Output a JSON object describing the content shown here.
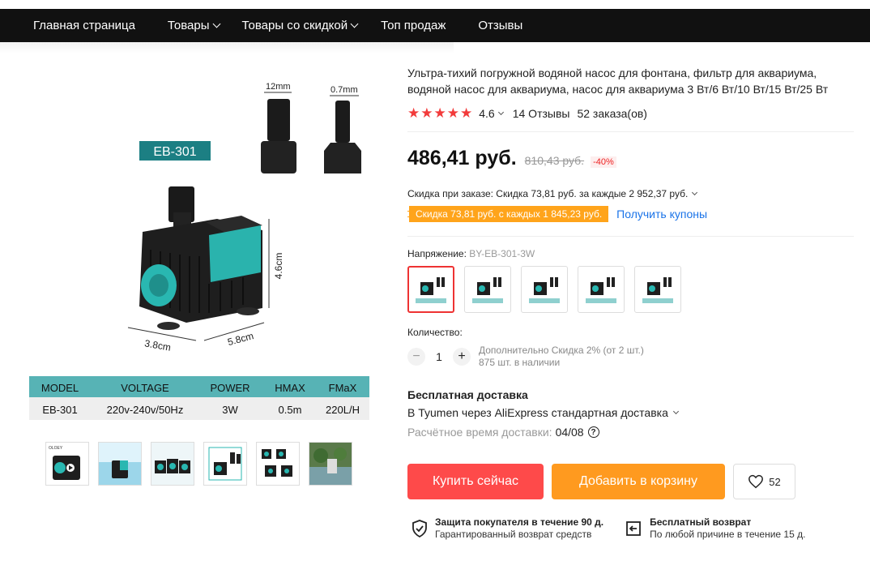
{
  "nav": {
    "items": [
      {
        "label": "Главная страница",
        "dropdown": false
      },
      {
        "label": "Товары",
        "dropdown": true
      },
      {
        "label": "Товары со скидкой",
        "dropdown": true
      },
      {
        "label": "Топ продаж",
        "dropdown": false
      },
      {
        "label": "Отзывы",
        "dropdown": false
      }
    ]
  },
  "gallery": {
    "model_tag": "EB-301",
    "dim_12mm": "12mm",
    "dim_07mm": "0.7mm",
    "dim_height": "4.6cm",
    "dim_depth": "3.8cm",
    "dim_width": "5.8cm",
    "spec_headers": [
      "MODEL",
      "VOLTAGE",
      "POWER",
      "HMAX",
      "FMaX"
    ],
    "spec_values": [
      "EB-301",
      "220v-240v/50Hz",
      "3W",
      "0.5m",
      "220L/H"
    ],
    "thumb_brand": "OLOEY",
    "accent_color": "#1fa8a0"
  },
  "product": {
    "title": "Ультра-тихий погружной водяной насос для фонтана, фильтр для аквариума, водяной насос для аквариума, насос для аквариума 3 Вт/6 Вт/10 Вт/15 Вт/25 Вт",
    "rating": "4.6",
    "stars": 5,
    "reviews": "14 Отзывы",
    "orders": "52 заказа(ов)",
    "price": "486,41 руб.",
    "old_price": "810,43 руб.",
    "discount": "-40%",
    "order_discount": "Скидка при заказе: Скидка 73,81 руб. за каждые 2 952,37 руб.",
    "coupon": "Скидка 73,81 руб. с каждых 1 845,23 руб.",
    "coupon_link": "Получить купоны",
    "variant_label": "Напряжение:",
    "variant_value": "BY-EB-301-3W",
    "quantity_label": "Количество:",
    "quantity": "1",
    "qty_minus": "−",
    "qty_plus": "+",
    "qty_discount": "Дополнительно Скидка 2% (от 2 шт.)",
    "stock": "875 шт. в наличии"
  },
  "shipping": {
    "title": "Бесплатная доставка",
    "via": "В Tyumen через AliExpress стандартная доставка",
    "eta_label": "Расчётное время доставки:",
    "eta_value": "04/08",
    "help": "?"
  },
  "actions": {
    "buy": "Купить сейчас",
    "cart": "Добавить в корзину",
    "wishlist_count": "52"
  },
  "guarantees": [
    {
      "title": "Защита покупателя в течение 90 д.",
      "subtitle": "Гарантированный возврат средств"
    },
    {
      "title": "Бесплатный возврат",
      "subtitle": "По любой причине в течение 15 д."
    }
  ],
  "colors": {
    "buy": "#fe4a4a",
    "cart": "#ff9a1f",
    "star": "#f23b3b",
    "coupon": "#ffa41b",
    "link": "#1a73e8"
  }
}
